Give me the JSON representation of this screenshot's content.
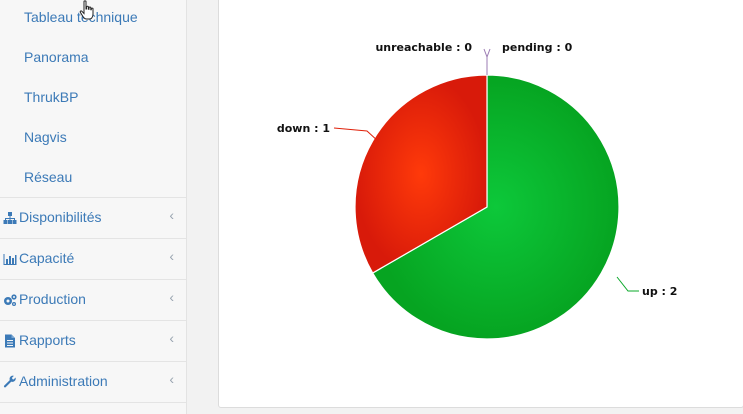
{
  "sidebar": {
    "sub_items": [
      "Tableau technique",
      "Panorama",
      "ThrukBP",
      "Nagvis",
      "Réseau"
    ],
    "menu": [
      {
        "label": "Disponibilités",
        "icon": "sitemap-icon"
      },
      {
        "label": "Capacité",
        "icon": "bar-chart-icon"
      },
      {
        "label": "Production",
        "icon": "gears-icon"
      },
      {
        "label": "Rapports",
        "icon": "file-text-icon"
      },
      {
        "label": "Administration",
        "icon": "wrench-icon"
      }
    ],
    "chevron": "‹"
  },
  "colors": {
    "link": "#3c7ab7",
    "up": "#0aa82a",
    "down": "#e0210a",
    "unreachable_pending": "#9b7bb3"
  },
  "chart_data": {
    "type": "pie",
    "slices": [
      {
        "label": "up",
        "value": 2,
        "text": "up : 2",
        "color": "#0aa82a"
      },
      {
        "label": "down",
        "value": 1,
        "text": "down : 1",
        "color": "#e0210a"
      },
      {
        "label": "unreachable",
        "value": 0,
        "text": "unreachable : 0",
        "color": "#9b7bb3"
      },
      {
        "label": "pending",
        "value": 0,
        "text": "pending : 0",
        "color": "#9b7bb3"
      }
    ]
  }
}
